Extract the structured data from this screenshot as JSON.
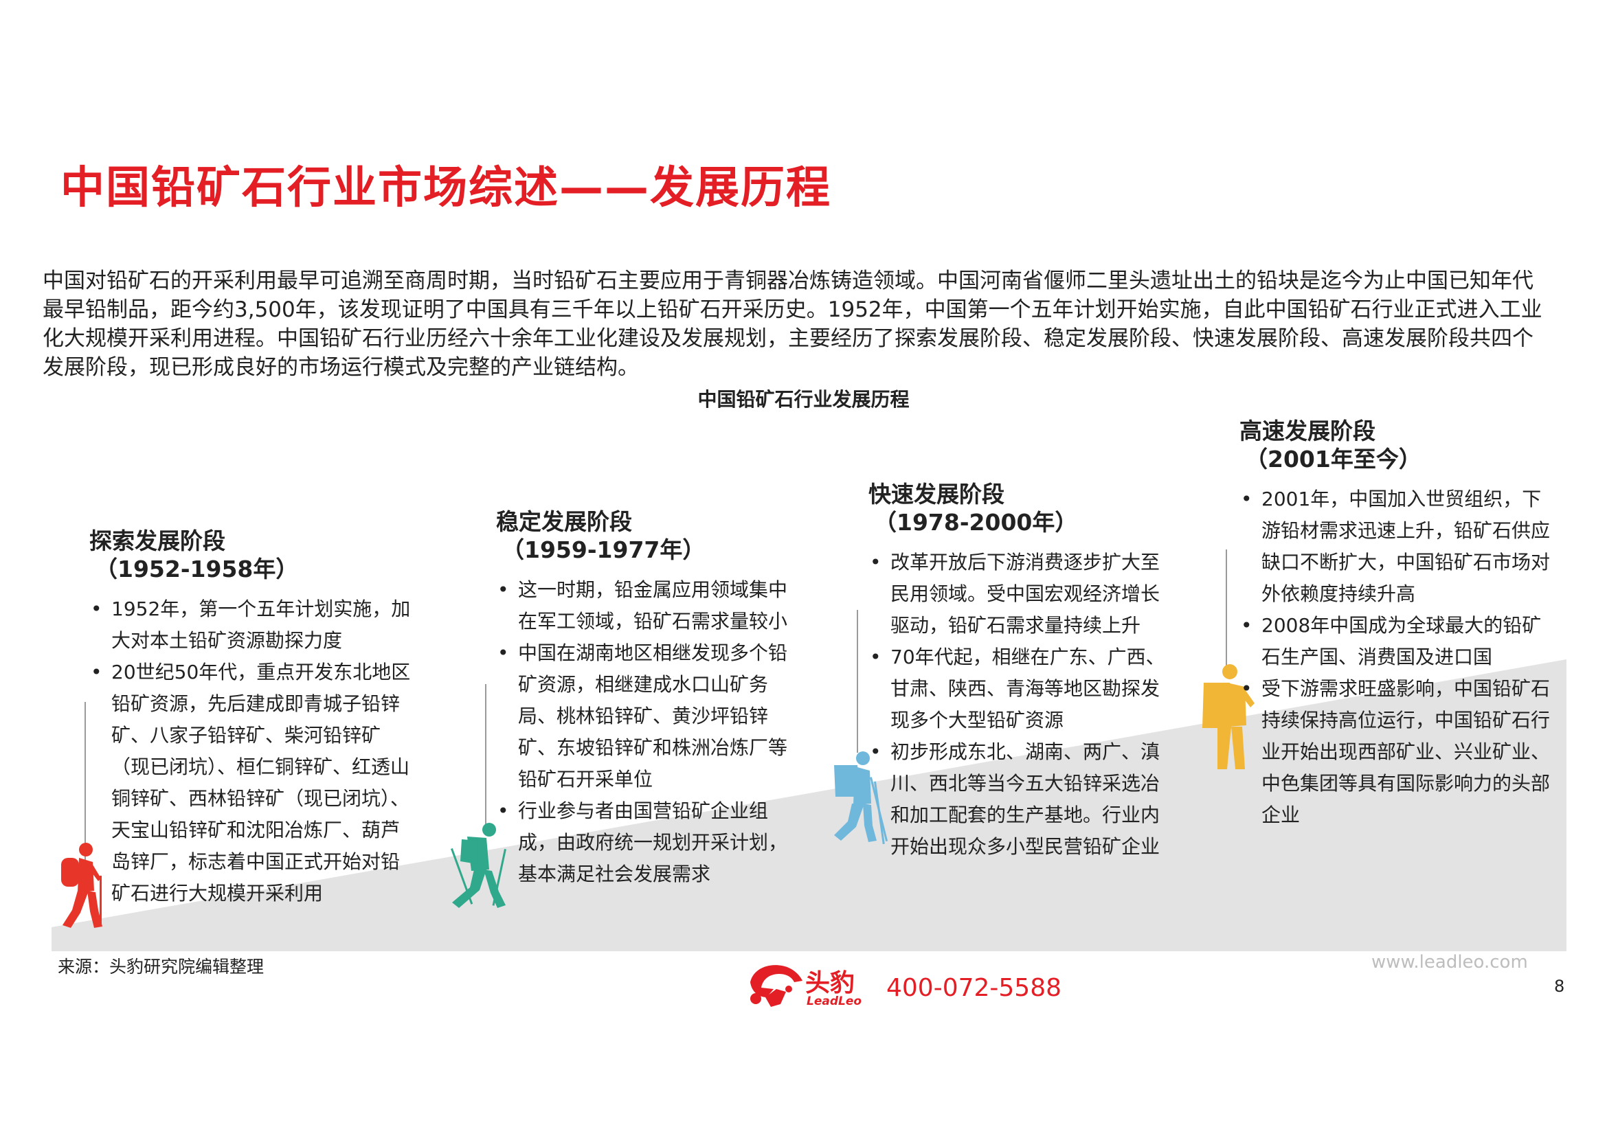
{
  "title": "中国铅矿石行业市场综述——发展历程",
  "intro": "中国对铅矿石的开采利用最早可追溯至商周时期，当时铅矿石主要应用于青铜器冶炼铸造领域。中国河南省偃师二里头遗址出土的铅块是迄今为止中国已知年代最早铅制品，距今约3,500年，该发现证明了中国具有三千年以上铅矿石开采历史。1952年，中国第一个五年计划开始实施，自此中国铅矿石行业正式进入工业化大规模开采利用进程。中国铅矿石行业历经六十余年工业化建设及发展规划，主要经历了探索发展阶段、稳定发展阶段、快速发展阶段、高速发展阶段共四个发展阶段，现已形成良好的市场运行模式及完整的产业链结构。",
  "chart_title": "中国铅矿石行业发展历程",
  "stages": [
    {
      "name": "探索发展阶段",
      "years": "（1952-1958年）",
      "bullets": [
        "1952年，第一个五年计划实施，加大对本土铅矿资源勘探力度",
        "20世纪50年代，重点开发东北地区铅矿资源，先后建成即青城子铅锌矿、八家子铅锌矿、柴河铅锌矿（现已闭坑）、桓仁铜锌矿、红透山铜锌矿、西林铅锌矿（现已闭坑）、天宝山铅锌矿和沈阳冶炼厂、葫芦岛锌厂，标志着中国正式开始对铅矿石进行大规模开采利用"
      ],
      "color": "#e8352a"
    },
    {
      "name": "稳定发展阶段",
      "years": "（1959-1977年）",
      "bullets": [
        "这一时期，铅金属应用领域集中在军工领域，铅矿石需求量较小",
        "中国在湖南地区相继发现多个铅矿资源，相继建成水口山矿务局、桃林铅锌矿、黄沙坪铅锌矿、东坡铅锌矿和株洲冶炼厂等铅矿石开采单位",
        "行业参与者由国营铅矿企业组成，由政府统一规划开采计划，基本满足社会发展需求"
      ],
      "color": "#2fa88b"
    },
    {
      "name": "快速发展阶段",
      "years": "（1978-2000年）",
      "bullets": [
        "改革开放后下游消费逐步扩大至民用领域。受中国宏观经济增长驱动，铅矿石需求量持续上升",
        "70年代起，相继在广东、广西、甘肃、陕西、青海等地区勘探发现多个大型铅矿资源",
        "初步形成东北、湖南、两广、滇川、西北等当今五大铅锌采选冶和加工配套的生产基地。行业内开始出现众多小型民营铅矿企业"
      ],
      "color": "#6fb8dc"
    },
    {
      "name": "高速发展阶段",
      "years": "（2001年至今）",
      "bullets": [
        "2001年，中国加入世贸组织，下游铅材需求迅速上升，铅矿石供应缺口不断扩大，中国铅矿石市场对外依赖度持续升高",
        "2008年中国成为全球最大的铅矿石生产国、消费国及进口国",
        "受下游需求旺盛影响，中国铅矿石持续保持高位运行，中国铅矿石行业开始出现西部矿业、兴业矿业、中色集团等具有国际影响力的头部企业"
      ],
      "color": "#f2b636"
    }
  ],
  "source": "来源：头豹研究院编辑整理",
  "logo": {
    "text": "头豹",
    "sub": "LeadLeo"
  },
  "phone": "400-072-5588",
  "website": "www.leadleo.com",
  "page_number": "8"
}
